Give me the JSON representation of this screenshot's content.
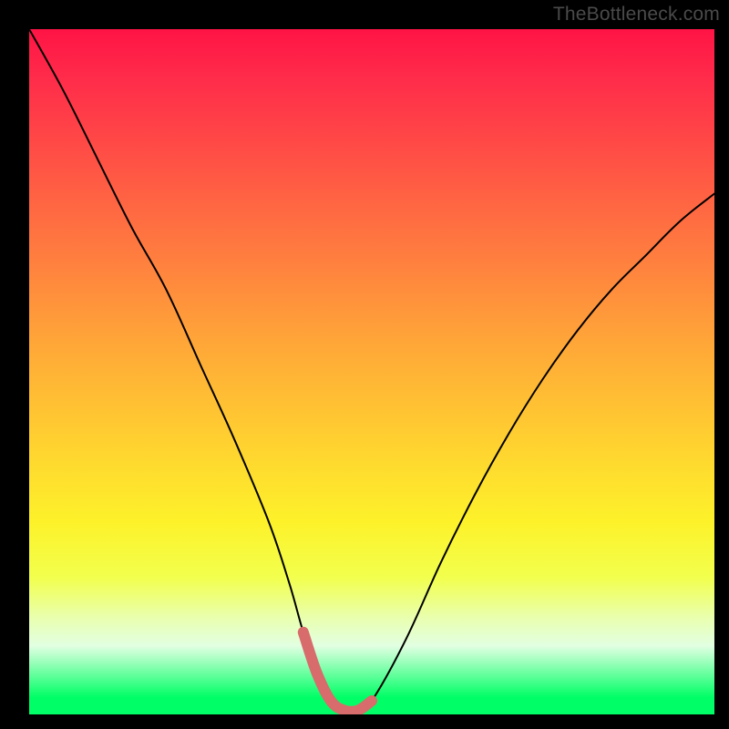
{
  "watermark": "TheBottleneck.com",
  "chart_data": {
    "type": "line",
    "title": "",
    "xlabel": "",
    "ylabel": "",
    "xlim": [
      0,
      100
    ],
    "ylim": [
      0,
      100
    ],
    "series": [
      {
        "name": "bottleneck-curve",
        "x": [
          0,
          5,
          10,
          15,
          20,
          25,
          30,
          35,
          38,
          40,
          42,
          44,
          46,
          48,
          50,
          55,
          60,
          65,
          70,
          75,
          80,
          85,
          90,
          95,
          100
        ],
        "y": [
          100,
          91,
          81,
          71,
          62,
          51,
          40,
          28,
          19,
          12,
          6,
          2,
          0.6,
          0.6,
          2,
          11,
          22,
          32,
          41,
          49,
          56,
          62,
          67,
          72,
          76
        ]
      }
    ],
    "highlight": {
      "name": "optimal-zone",
      "x": [
        40,
        42,
        44,
        46,
        48,
        50
      ],
      "y": [
        12,
        6,
        2,
        0.6,
        0.6,
        2
      ]
    },
    "background_gradient": {
      "stops": [
        {
          "pos": 0.0,
          "color": "#ff1445"
        },
        {
          "pos": 0.2,
          "color": "#ff5445"
        },
        {
          "pos": 0.46,
          "color": "#ffa738"
        },
        {
          "pos": 0.72,
          "color": "#fdf22a"
        },
        {
          "pos": 0.9,
          "color": "#e2ffe2"
        },
        {
          "pos": 1.0,
          "color": "#00ff66"
        }
      ]
    }
  }
}
